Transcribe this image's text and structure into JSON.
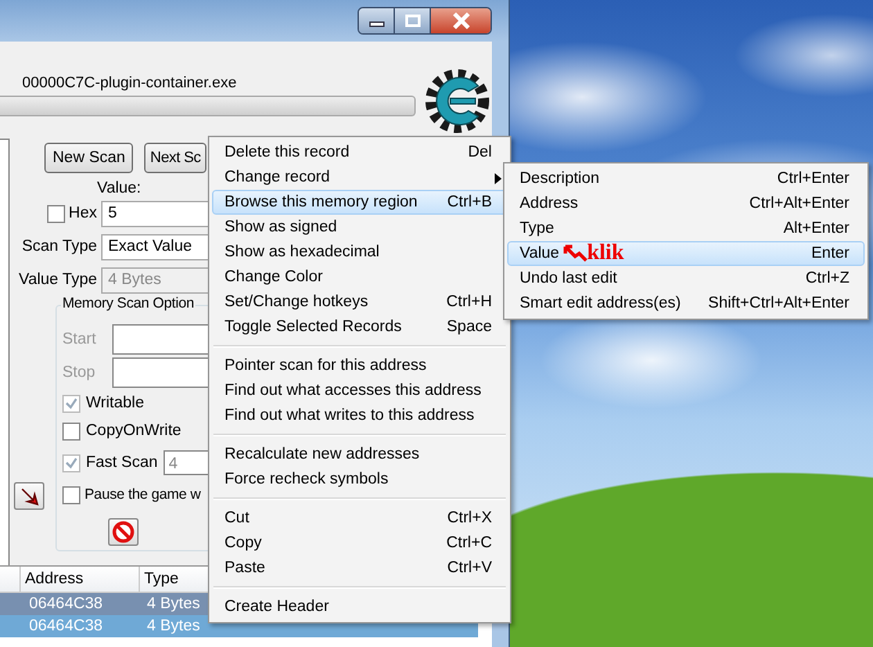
{
  "process": {
    "name": "00000C7C-plugin-container.exe",
    "level": 0
  },
  "scan_buttons": [
    "New Scan",
    "Next Sc"
  ],
  "value": {
    "label": "Value:",
    "hex_label": "Hex",
    "hex_checked": false,
    "value": "5"
  },
  "scan_type": {
    "label": "Scan Type",
    "value": "Exact Value"
  },
  "value_type": {
    "label": "Value Type",
    "value": "4 Bytes",
    "disabled": true
  },
  "memory_scan_options": {
    "title": "Memory Scan Option",
    "start_label": "Start",
    "stop_label": "Stop",
    "options": [
      {
        "label": "Writable",
        "checked": true
      },
      {
        "label": "CopyOnWrite",
        "checked": false
      }
    ],
    "fast_scan": {
      "label": "Fast Scan",
      "checked": true,
      "value": "4"
    },
    "pause": {
      "label": "Pause the game w",
      "checked": false
    }
  },
  "address_list": {
    "columns": [
      "Address",
      "Type"
    ],
    "rows": [
      {
        "address": "06464C38",
        "type": "4 Bytes",
        "selected": true
      },
      {
        "address": "06464C38",
        "type": "4 Bytes",
        "selected": false
      }
    ]
  },
  "context_menu": {
    "groups": [
      [
        {
          "label": "Delete this record",
          "shortcut": "Del",
          "selected": false,
          "submenu": false
        },
        {
          "label": "Change record",
          "selected": false,
          "submenu": true
        },
        {
          "label": "Browse this memory region",
          "shortcut": "Ctrl+B",
          "selected": true,
          "submenu": false
        },
        {
          "label": "Show as signed",
          "selected": false,
          "submenu": false
        },
        {
          "label": "Show as hexadecimal",
          "selected": false,
          "submenu": false
        },
        {
          "label": "Change Color",
          "selected": false,
          "submenu": false
        },
        {
          "label": "Set/Change hotkeys",
          "shortcut": "Ctrl+H",
          "selected": false,
          "submenu": false
        },
        {
          "label": "Toggle Selected Records",
          "shortcut": "Space",
          "selected": false,
          "submenu": false
        }
      ],
      [
        {
          "label": "Pointer scan for this address",
          "selected": false,
          "submenu": false
        },
        {
          "label": "Find out what accesses this address",
          "selected": false,
          "submenu": false
        },
        {
          "label": "Find out what writes to this address",
          "selected": false,
          "submenu": false
        }
      ],
      [
        {
          "label": "Recalculate new addresses",
          "selected": false,
          "submenu": false
        },
        {
          "label": "Force recheck symbols",
          "selected": false,
          "submenu": false
        }
      ],
      [
        {
          "label": "Cut",
          "shortcut": "Ctrl+X",
          "selected": false,
          "submenu": false
        },
        {
          "label": "Copy",
          "shortcut": "Ctrl+C",
          "selected": false,
          "submenu": false
        },
        {
          "label": "Paste",
          "shortcut": "Ctrl+V",
          "selected": false,
          "submenu": false
        }
      ],
      [
        {
          "label": "Create Header",
          "selected": false,
          "submenu": false
        }
      ]
    ]
  },
  "submenu": {
    "items": [
      {
        "label": "Description",
        "shortcut": "Ctrl+Enter",
        "selected": false
      },
      {
        "label": "Address",
        "shortcut": "Ctrl+Alt+Enter",
        "selected": false
      },
      {
        "label": "Type",
        "shortcut": "Alt+Enter",
        "selected": false
      },
      {
        "label": "Value",
        "shortcut": "Enter",
        "selected": true,
        "annotation": "klik"
      },
      {
        "label": "Undo last edit",
        "shortcut": "Ctrl+Z",
        "selected": false
      },
      {
        "label": "Smart edit address(es)",
        "shortcut": "Shift+Ctrl+Alt+Enter",
        "selected": false
      }
    ]
  }
}
